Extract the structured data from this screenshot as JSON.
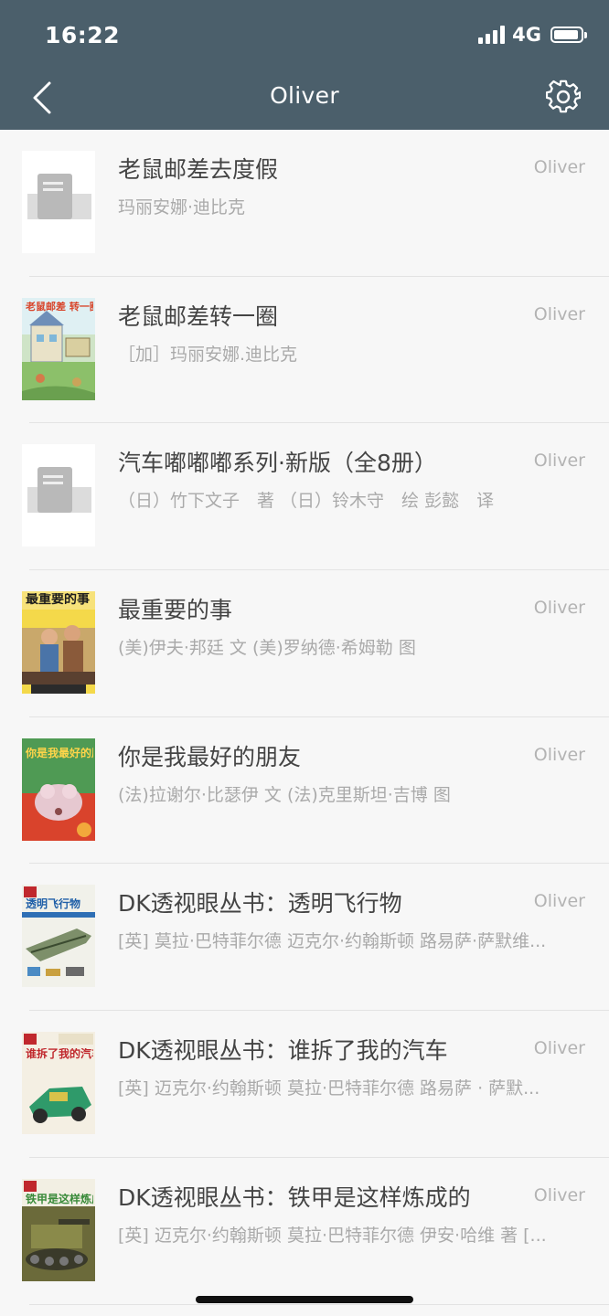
{
  "status_bar": {
    "time": "16:22",
    "network": "4G"
  },
  "nav": {
    "title": "Oliver"
  },
  "books": [
    {
      "title": "老鼠邮差去度假",
      "author": "玛丽安娜·迪比克",
      "owner": "Oliver",
      "cover": "placeholder"
    },
    {
      "title": "老鼠邮差转一圈",
      "author": "［加］玛丽安娜.迪比克",
      "owner": "Oliver",
      "cover": "illustrated-house"
    },
    {
      "title": "汽车嘟嘟嘟系列·新版（全8册）",
      "author": "（日）竹下文子　著 （日）铃木守　绘 彭懿　译",
      "owner": "Oliver",
      "cover": "placeholder"
    },
    {
      "title": "最重要的事",
      "author": "(美)伊夫·邦廷 文 (美)罗纳德·希姆勒 图",
      "owner": "Oliver",
      "cover": "illustrated-boys",
      "cover_text": "最重要的事"
    },
    {
      "title": "你是我最好的朋友",
      "author": "(法)拉谢尔·比瑟伊 文 (法)克里斯坦·吉博 图",
      "owner": "Oliver",
      "cover": "illustrated-mouse",
      "cover_text": "你是我最好的朋友"
    },
    {
      "title": "DK透视眼丛书：透明飞行物",
      "author": "[英] 莫拉·巴特菲尔德 迈克尔·约翰斯顿 路易萨·萨默维...",
      "owner": "Oliver",
      "cover": "dk-plane",
      "cover_text": "透明飞行物"
    },
    {
      "title": "DK透视眼丛书：谁拆了我的汽车",
      "author": "[英] 迈克尔·约翰斯顿 莫拉·巴特菲尔德 路易萨 · 萨默...",
      "owner": "Oliver",
      "cover": "dk-car",
      "cover_text": "谁拆了我的汽车"
    },
    {
      "title": "DK透视眼丛书：铁甲是这样炼成的",
      "author": "[英] 迈克尔·约翰斯顿 莫拉·巴特菲尔德 伊安·哈维 著 [...",
      "owner": "Oliver",
      "cover": "dk-tank",
      "cover_text": "铁甲是这样炼成的"
    }
  ]
}
